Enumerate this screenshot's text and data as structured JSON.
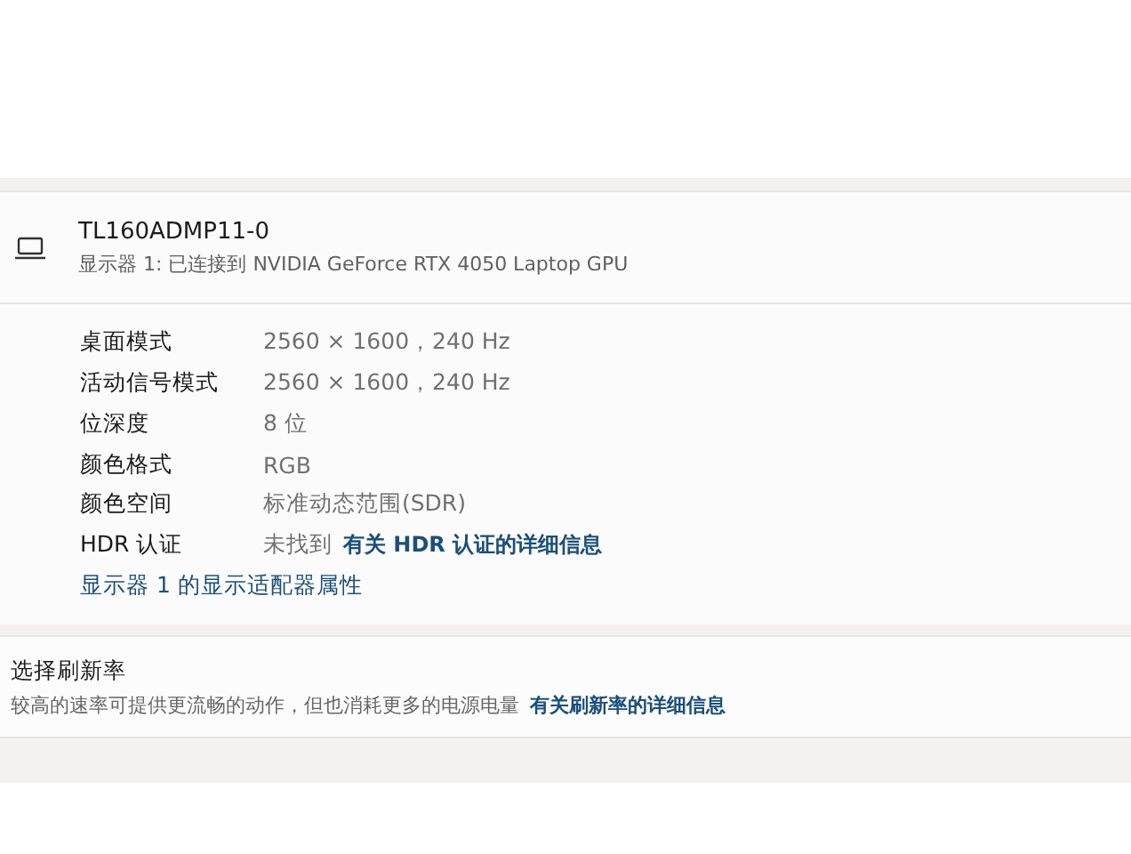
{
  "display": {
    "name": "TL160ADMP11-0",
    "subtitle": "显示器 1: 已连接到 NVIDIA GeForce RTX 4050 Laptop GPU"
  },
  "details": [
    {
      "label": "桌面模式",
      "value": "2560 × 1600，240 Hz"
    },
    {
      "label": "活动信号模式",
      "value": "2560 × 1600，240 Hz"
    },
    {
      "label": "位深度",
      "value": "8 位"
    },
    {
      "label": "颜色格式",
      "value": "RGB"
    },
    {
      "label": "颜色空间",
      "value": "标准动态范围(SDR)"
    },
    {
      "label": "HDR 认证",
      "value": "未找到",
      "link": "有关 HDR 认证的详细信息"
    }
  ],
  "adapter_link": "显示器 1 的显示适配器属性",
  "refresh": {
    "title": "选择刷新率",
    "description": "较高的速率可提供更流畅的动作，但也消耗更多的电源电量",
    "link": "有关刷新率的详细信息"
  }
}
